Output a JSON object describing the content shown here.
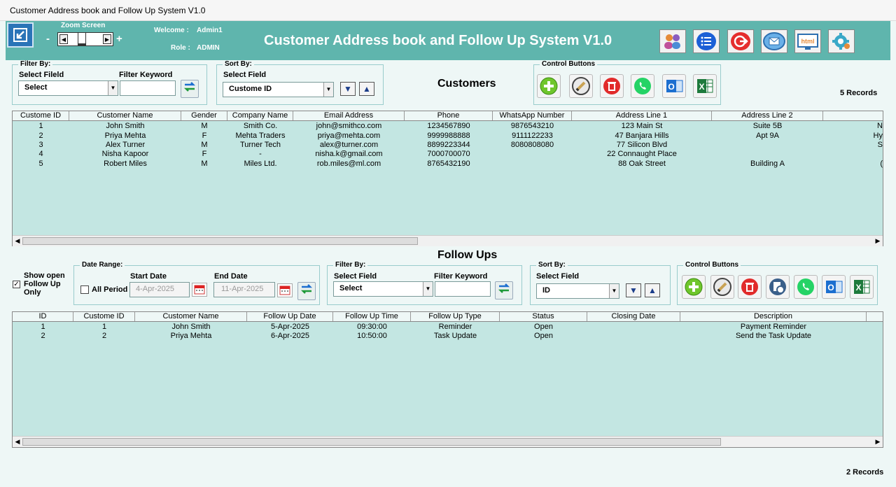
{
  "window_title": "Customer Address book and Follow Up System V1.0",
  "header": {
    "zoom_label": "Zoom Screen",
    "zoom_minus": "-",
    "zoom_plus": "+",
    "welcome_label": "Welcome :",
    "welcome_value": "Admin1",
    "role_label": "Role :",
    "role_value": "ADMIN",
    "title": "Customer Address book and Follow Up System V1.0",
    "icons": [
      "users-icon",
      "list-icon",
      "logout-icon",
      "email-icon",
      "html-icon",
      "settings-icon"
    ]
  },
  "customers": {
    "filter_group": "Filter By:",
    "filter_field_label": "Select Fileld",
    "filter_field_value": "Select",
    "filter_keyword_label": "Filter Keyword",
    "sort_group": "Sort By:",
    "sort_field_label": "Select Field",
    "sort_field_value": "Custome ID",
    "section_title": "Customers",
    "control_group": "Control Buttons",
    "records": "5 Records",
    "columns": [
      "Custome ID",
      "Customer Name",
      "Gender",
      "Company Name",
      "Email Address",
      "Phone",
      "WhatsApp Number",
      "Address Line 1",
      "Address Line 2",
      ""
    ],
    "rows": [
      [
        "1",
        "John Smith",
        "M",
        "Smith Co.",
        "john@smithco.com",
        "1234567890",
        "9876543210",
        "123 Main St",
        "Suite 5B",
        "N"
      ],
      [
        "2",
        "Priya Mehta",
        "F",
        "Mehta Traders",
        "priya@mehta.com",
        "9999988888",
        "9111122233",
        "47 Banjara Hills",
        "Apt 9A",
        "Hy"
      ],
      [
        "3",
        "Alex Turner",
        "M",
        "Turner Tech",
        "alex@turner.com",
        "8899223344",
        "8080808080",
        "77 Silicon Blvd",
        "",
        "S"
      ],
      [
        "4",
        "Nisha Kapoor",
        "F",
        "-",
        "nisha.k@gmail.com",
        "7000700070",
        "",
        "22 Connaught Place",
        "",
        ""
      ],
      [
        "5",
        "Robert Miles",
        "M",
        "Miles Ltd.",
        "rob.miles@ml.com",
        "8765432190",
        "",
        "88 Oak Street",
        "Building A",
        "("
      ]
    ]
  },
  "followups": {
    "section_title": "Follow Ups",
    "show_open_label": "Show open Follow Up Only",
    "date_group": "Date Range:",
    "all_period_label": "All Period",
    "start_date_label": "Start Date",
    "start_date_value": "4-Apr-2025",
    "end_date_label": "End Date",
    "end_date_value": "11-Apr-2025",
    "filter_group": "Filter By:",
    "filter_field_label": "Select Field",
    "filter_field_value": "Select",
    "filter_keyword_label": "Filter Keyword",
    "sort_group": "Sort By:",
    "sort_field_label": "Select Field",
    "sort_field_value": "ID",
    "control_group": "Control Buttons",
    "records": "2 Records",
    "columns": [
      "ID",
      "Custome ID",
      "Customer Name",
      "Follow Up Date",
      "Follow Up Time",
      "Follow Up Type",
      "Status",
      "Closing Date",
      "Description"
    ],
    "rows": [
      [
        "1",
        "1",
        "John Smith",
        "5-Apr-2025",
        "09:30:00",
        "Reminder",
        "Open",
        "",
        "Payment Reminder"
      ],
      [
        "2",
        "2",
        "Priya Mehta",
        "6-Apr-2025",
        "10:50:00",
        "Task Update",
        "Open",
        "",
        "Send the Task Update"
      ]
    ]
  }
}
